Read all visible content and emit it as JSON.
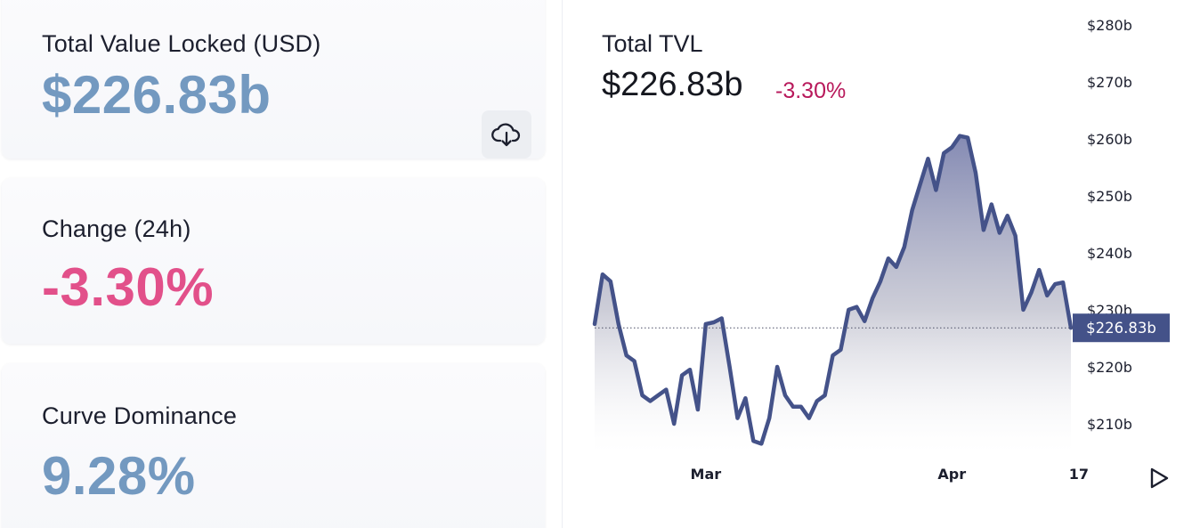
{
  "stats": {
    "tvl": {
      "label": "Total Value Locked (USD)",
      "value": "$226.83b"
    },
    "change": {
      "label": "Change (24h)",
      "value": "-3.30%"
    },
    "dominance": {
      "label": "Curve Dominance",
      "value": "9.28%"
    },
    "download_icon": "cloud-download-icon"
  },
  "colors": {
    "tvl_value": "#7399c0",
    "change_value": "#e2508a",
    "dominance_value": "#7399c0",
    "chart_change": "#b8195b",
    "line": "#445289",
    "price_tag_bg": "#445289"
  },
  "chart_header": {
    "title": "Total TVL",
    "value": "$226.83b",
    "change": "-3.30%"
  },
  "play_icon": "play-icon",
  "chart_data": {
    "type": "area",
    "title": "Total TVL",
    "y_unit": "$ billions",
    "ylim": [
      205,
      282
    ],
    "y_ticks": [
      {
        "value": 210,
        "label": "$210b"
      },
      {
        "value": 220,
        "label": "$220b"
      },
      {
        "value": 230,
        "label": "$230b"
      },
      {
        "value": 240,
        "label": "$240b"
      },
      {
        "value": 250,
        "label": "$250b"
      },
      {
        "value": 260,
        "label": "$260b"
      },
      {
        "value": 270,
        "label": "$270b"
      },
      {
        "value": 280,
        "label": "$280b"
      }
    ],
    "x_ticks": [
      {
        "day": 14,
        "label": "Mar"
      },
      {
        "day": 45,
        "label": "Apr"
      },
      {
        "day": 61,
        "label": "17"
      }
    ],
    "current_value": 226.83,
    "current_label": "$226.83b",
    "grid": false,
    "series": [
      {
        "values": [
          227.5,
          236.2,
          235.0,
          227.5,
          222.0,
          221.0,
          215.0,
          214.0,
          215.0,
          216.0,
          210.0,
          218.5,
          219.5,
          212.5,
          227.5,
          227.8,
          228.5,
          220.0,
          211.0,
          214.5,
          207.0,
          206.5,
          211.0,
          220.0,
          215.0,
          213.0,
          213.0,
          211.0,
          214.0,
          215.0,
          222.0,
          223.0,
          230.0,
          230.5,
          228.0,
          232.0,
          235.0,
          239.0,
          237.5,
          241.0,
          247.5,
          252.0,
          256.5,
          251.0,
          257.5,
          258.5,
          260.5,
          260.2,
          254.0,
          244.0,
          248.5,
          243.5,
          246.5,
          243.0,
          230.0,
          233.0,
          237.0,
          232.5,
          234.5,
          234.8,
          226.83
        ]
      }
    ]
  }
}
